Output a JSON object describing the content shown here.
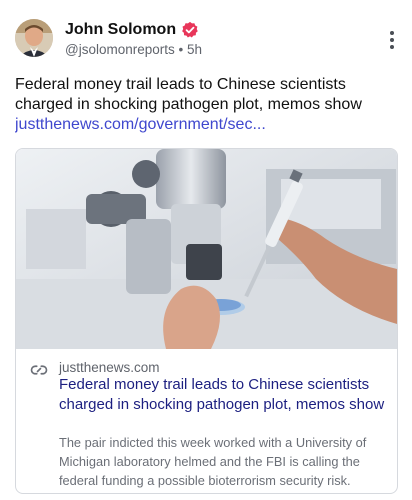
{
  "author": {
    "name": "John Solomon",
    "handle": "@jsolomonreports",
    "separator": "•",
    "time": "5h",
    "verified_color": "#e8365a"
  },
  "post": {
    "text": "Federal money trail leads to Chinese scientists charged in shocking pathogen plot, memos show",
    "link_text": "justthenews.com/government/sec..."
  },
  "card": {
    "domain": "justthenews.com",
    "title": "Federal money trail leads to Chinese scientists charged in shocking pathogen plot, memos show",
    "description": "The pair indicted this week worked with a University of Michigan laboratory helmed and the FBI is calling the federal funding a possible bioterrorism security risk."
  },
  "icons": {
    "more": "more-vertical-icon",
    "link": "link-icon",
    "verified": "verified-badge-icon"
  },
  "colors": {
    "link": "#3f47ce",
    "card_title": "#1c1f80",
    "muted": "#60646c"
  }
}
